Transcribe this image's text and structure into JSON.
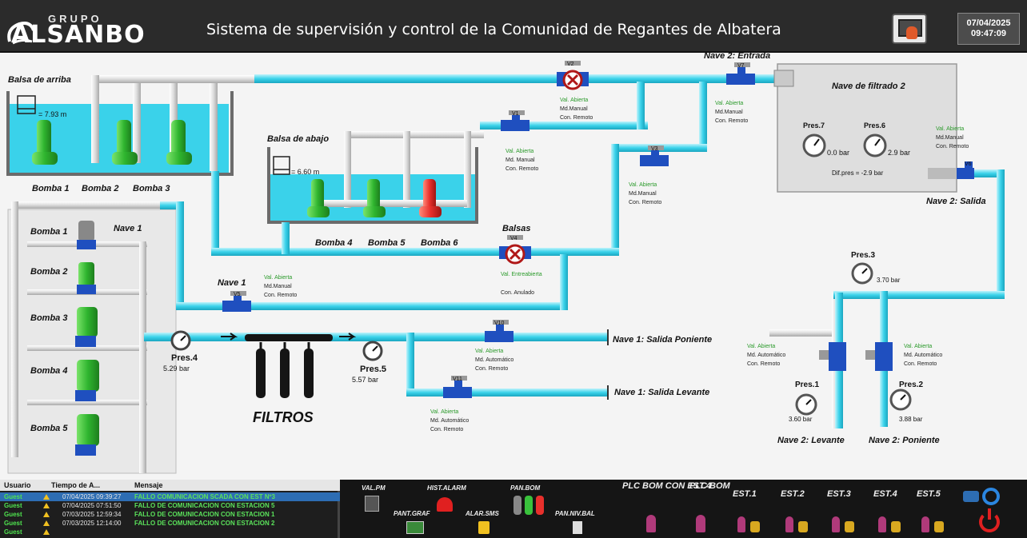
{
  "header": {
    "logo_small": "GRUPO",
    "logo_main": "ALSANBO",
    "title": "Sistema de supervisión y control de la Comunidad de Regantes de Albatera",
    "date": "07/04/2025",
    "time": "09:47:09"
  },
  "scada": {
    "balsa_arriba": {
      "label": "Balsa de arriba",
      "level": "= 7.93 m"
    },
    "balsa_abajo": {
      "label": "Balsa de abajo",
      "level": "= 6.60 m"
    },
    "pumps_top": [
      "Bomba 1",
      "Bomba 2",
      "Bomba 3"
    ],
    "pumps_mid": [
      "Bomba 4",
      "Bomba 5",
      "Bomba 6"
    ],
    "nave1": {
      "label": "Nave 1",
      "pumps": [
        "Bomba 1",
        "Bomba 2",
        "Bomba 3",
        "Bomba 4",
        "Bomba 5"
      ]
    },
    "valves": {
      "v2": {
        "tag": "V2",
        "lines": [
          "Val. Abierta",
          "Md.Manual",
          "Con. Remoto"
        ]
      },
      "v1": {
        "tag": "V1",
        "lines": [
          "Val. Abierta",
          "Md. Manual",
          "Con. Remoto"
        ]
      },
      "v3": {
        "tag": "V3",
        "lines": [
          "Val. Abierta",
          "Md.Manual",
          "Con. Remoto"
        ]
      },
      "v4": {
        "tag": "V4",
        "title": "Balsas",
        "lines": [
          "Val. Entreabierta",
          "Con. Anulado"
        ]
      },
      "v5": {
        "tag": "V5",
        "title": "Nave 1",
        "lines": [
          "Val. Abierta",
          "Md.Manual",
          "Con. Remoto"
        ]
      },
      "v10": {
        "tag": "V10",
        "lines": [
          "Val. Abierta",
          "Md. Automático",
          "Con. Remoto"
        ]
      },
      "v11": {
        "tag": "V11",
        "lines": [
          "Val. Abierta",
          "Md. Automático",
          "Con. Remoto"
        ]
      },
      "v7": {
        "tag": "V7",
        "title": "Nave 2: Entrada",
        "lines": [
          "Val. Abierta",
          "Md.Manual",
          "Con. Remoto"
        ]
      },
      "v6": {
        "tag": "V6",
        "title": "Nave 2: Salida",
        "lines": [
          "Val. Abierta",
          "Md.Manual",
          "Con. Remoto"
        ]
      },
      "v8": {
        "lines": [
          "Val. Abierta",
          "Md. Automático",
          "Con. Remoto"
        ]
      },
      "v9": {
        "lines": [
          "Val. Abierta",
          "Md. Automático",
          "Con. Remoto"
        ]
      }
    },
    "filtrado": {
      "title": "Nave de filtrado 2",
      "pres7": {
        "label": "Pres.7",
        "value": "0.0 bar"
      },
      "pres6": {
        "label": "Pres.6",
        "value": "2.9 bar"
      },
      "dif": "Dif.pres = -2.9 bar"
    },
    "pressures": {
      "pres4": {
        "label": "Pres.4",
        "value": "5.29 bar"
      },
      "pres5": {
        "label": "Pres.5",
        "value": "5.57 bar"
      },
      "pres3": {
        "label": "Pres.3",
        "value": "3.70 bar"
      },
      "pres1": {
        "label": "Pres.1",
        "value": "3.60 bar"
      },
      "pres2": {
        "label": "Pres.2",
        "value": "3.88 bar"
      }
    },
    "filtros": "FILTROS",
    "outputs": {
      "poniente1": "Nave 1: Salida Poniente",
      "levante1": "Nave 1: Salida Levante",
      "levante2": "Nave 2: Levante",
      "poniente2": "Nave 2: Poniente"
    }
  },
  "alarms": {
    "headers": {
      "user": "Usuario",
      "time": "Tiempo de A...",
      "msg": "Mensaje"
    },
    "rows": [
      {
        "user": "Guest",
        "time": "07/04/2025 09:39:27",
        "msg": "FALLO COMUNICACION SCADA CON EST Nº3"
      },
      {
        "user": "Guest",
        "time": "07/04/2025 07:51:50",
        "msg": "FALLO DE COMUNICACION CON ESTACION 5"
      },
      {
        "user": "Guest",
        "time": "07/03/2025 12:59:34",
        "msg": "FALLO DE COMUNICACION CON ESTACION 1"
      },
      {
        "user": "Guest",
        "time": "07/03/2025 12:14:00",
        "msg": "FALLO DE COMUNICACION CON ESTACION 2"
      },
      {
        "user": "Guest",
        "time": "",
        "msg": ""
      }
    ]
  },
  "controls": {
    "val_pm": "VAL.PM",
    "hist_alarm": "HIST.ALARM",
    "pan_bom": "PAN.BOM",
    "pant_graf": "PANT.GRAF",
    "alar_sms": "ALAR.SMS",
    "pan_niv_bal": "PAN.NIV.BAL",
    "plc_bom_est4": "PLC BOM CON EST.4",
    "plc_bom": "PLC BOM",
    "est": [
      "EST.1",
      "EST.2",
      "EST.3",
      "EST.4",
      "EST.5"
    ]
  },
  "colors": {
    "water": "#3ad2ea",
    "pump_on": "#39c23c",
    "pump_off": "#e8302c",
    "valve": "#1f4fbf"
  }
}
